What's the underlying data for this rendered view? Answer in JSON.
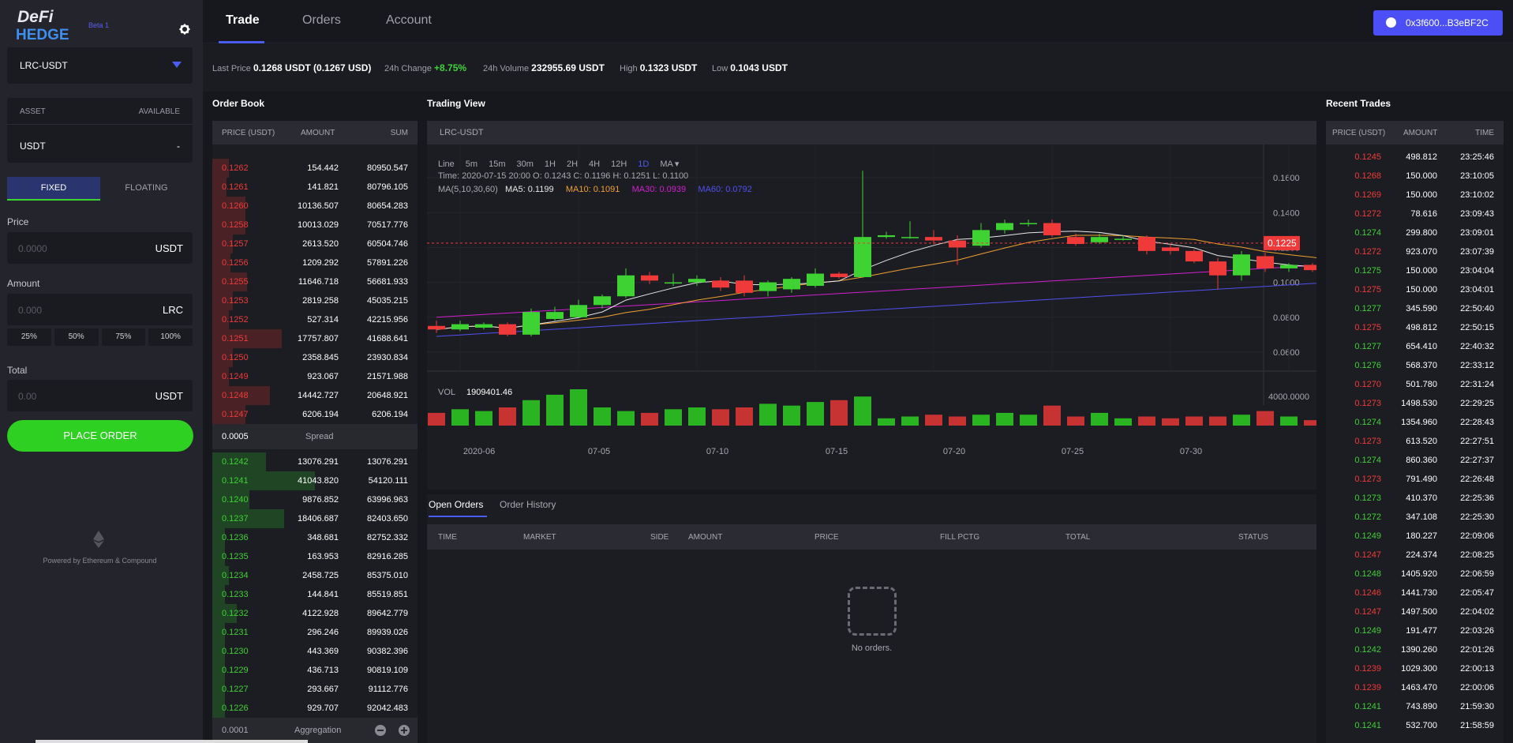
{
  "sidebar": {
    "logo_text": "DeFi HEDGE",
    "beta_label": "Beta 1",
    "pair": "LRC-USDT",
    "asset_header": "ASSET",
    "available_header": "AVAILABLE",
    "asset_name": "USDT",
    "asset_available": "-",
    "tab_fixed": "FIXED",
    "tab_floating": "FLOATING",
    "price_label": "Price",
    "price_placeholder": "0.0000",
    "price_unit": "USDT",
    "amount_label": "Amount",
    "amount_placeholder": "0.000",
    "amount_unit": "LRC",
    "pct": [
      "25%",
      "50%",
      "75%",
      "100%"
    ],
    "total_label": "Total",
    "total_placeholder": "0.00",
    "total_unit": "USDT",
    "place_order": "PLACE ORDER",
    "powered": "Powered by Ethereum & Compound"
  },
  "nav": {
    "trade": "Trade",
    "orders": "Orders",
    "account": "Account",
    "wallet": "0x3f600...B3eBF2C"
  },
  "ticker": {
    "last_price_label": "Last Price",
    "last_price": "0.1268 USDT (0.1267 USD)",
    "change_label": "24h Change",
    "change": "+8.75%",
    "volume_label": "24h Volume",
    "volume": "232955.69 USDT",
    "high_label": "High",
    "high": "0.1323 USDT",
    "low_label": "Low",
    "low": "0.1043 USDT"
  },
  "orderbook": {
    "title": "Order Book",
    "headers": [
      "PRICE (USDT)",
      "AMOUNT",
      "SUM"
    ],
    "asks": [
      {
        "price": "0.1262",
        "amount": "154.442",
        "sum": "80950.547",
        "depth": 0.08
      },
      {
        "price": "0.1261",
        "amount": "141.821",
        "sum": "80796.105",
        "depth": 0.07
      },
      {
        "price": "0.1260",
        "amount": "10136.507",
        "sum": "80654.283",
        "depth": 0.16
      },
      {
        "price": "0.1258",
        "amount": "10013.029",
        "sum": "70517.776",
        "depth": 0.16
      },
      {
        "price": "0.1257",
        "amount": "2613.520",
        "sum": "60504.746",
        "depth": 0.1
      },
      {
        "price": "0.1256",
        "amount": "1209.292",
        "sum": "57891.226",
        "depth": 0.09
      },
      {
        "price": "0.1255",
        "amount": "11646.718",
        "sum": "56681.933",
        "depth": 0.17
      },
      {
        "price": "0.1253",
        "amount": "2819.258",
        "sum": "45035.215",
        "depth": 0.1
      },
      {
        "price": "0.1252",
        "amount": "527.314",
        "sum": "42215.956",
        "depth": 0.08
      },
      {
        "price": "0.1251",
        "amount": "17757.807",
        "sum": "41688.641",
        "depth": 0.34
      },
      {
        "price": "0.1250",
        "amount": "2358.845",
        "sum": "23930.834",
        "depth": 0.1
      },
      {
        "price": "0.1249",
        "amount": "923.067",
        "sum": "21571.988",
        "depth": 0.08
      },
      {
        "price": "0.1248",
        "amount": "14442.727",
        "sum": "20648.921",
        "depth": 0.28
      },
      {
        "price": "0.1247",
        "amount": "6206.194",
        "sum": "6206.194",
        "depth": 0.16
      }
    ],
    "spread_value": "0.0005",
    "spread_label": "Spread",
    "bids": [
      {
        "price": "0.1242",
        "amount": "13076.291",
        "sum": "13076.291",
        "depth": 0.26
      },
      {
        "price": "0.1241",
        "amount": "41043.820",
        "sum": "54120.111",
        "depth": 0.5
      },
      {
        "price": "0.1240",
        "amount": "9876.852",
        "sum": "63996.963",
        "depth": 0.18
      },
      {
        "price": "0.1237",
        "amount": "18406.687",
        "sum": "82403.650",
        "depth": 0.35
      },
      {
        "price": "0.1236",
        "amount": "348.681",
        "sum": "82752.332",
        "depth": 0.06
      },
      {
        "price": "0.1235",
        "amount": "163.953",
        "sum": "82916.285",
        "depth": 0.06
      },
      {
        "price": "0.1234",
        "amount": "2458.725",
        "sum": "85375.010",
        "depth": 0.08
      },
      {
        "price": "0.1233",
        "amount": "144.841",
        "sum": "85519.851",
        "depth": 0.06
      },
      {
        "price": "0.1232",
        "amount": "4122.928",
        "sum": "89642.779",
        "depth": 0.12
      },
      {
        "price": "0.1231",
        "amount": "296.246",
        "sum": "89939.026",
        "depth": 0.06
      },
      {
        "price": "0.1230",
        "amount": "443.369",
        "sum": "90382.396",
        "depth": 0.06
      },
      {
        "price": "0.1229",
        "amount": "436.713",
        "sum": "90819.109",
        "depth": 0.06
      },
      {
        "price": "0.1227",
        "amount": "293.667",
        "sum": "91112.776",
        "depth": 0.06
      },
      {
        "price": "0.1226",
        "amount": "929.707",
        "sum": "92042.483",
        "depth": 0.06
      }
    ],
    "agg_value": "0.0001",
    "agg_label": "Aggregation"
  },
  "tradingview": {
    "title": "Trading View",
    "symbol": "LRC-USDT",
    "intervals": [
      "Line",
      "5m",
      "15m",
      "30m",
      "1H",
      "2H",
      "4H",
      "12H",
      "1D",
      "MA"
    ],
    "selected_interval": "1D",
    "info": "Time: 2020-07-15 20:00    O: 0.1243    C: 0.1196    H: 0.1251    L: 0.1100",
    "ma_label": "MA(5,10,30,60)",
    "ma5": "MA5: 0.1199",
    "ma10": "MA10: 0.1091",
    "ma30": "MA30: 0.0939",
    "ma60": "MA60: 0.0792",
    "vol_label": "VOL",
    "vol_value": "1909401.46",
    "vol_axis": "4000.0000",
    "last_marker": "0.1225"
  },
  "chart_data": {
    "type": "candlestick",
    "y_ticks": [
      "0.1600",
      "0.1400",
      "0.1200",
      "0.1000",
      "0.0800",
      "0.0600"
    ],
    "ylim": [
      0.05,
      0.17
    ],
    "x_labels": [
      "2020-06",
      "07-05",
      "07-10",
      "07-15",
      "07-20",
      "07-25",
      "07-30"
    ],
    "candles": [
      [
        0.075,
        0.073,
        0.078,
        0.071,
        1
      ],
      [
        0.073,
        0.076,
        0.078,
        0.072,
        0
      ],
      [
        0.074,
        0.076,
        0.077,
        0.073,
        2
      ],
      [
        0.076,
        0.07,
        0.077,
        0.069,
        3
      ],
      [
        0.07,
        0.083,
        0.085,
        0.069,
        2
      ],
      [
        0.079,
        0.083,
        0.086,
        0.078,
        2
      ],
      [
        0.08,
        0.087,
        0.09,
        0.08,
        3
      ],
      [
        0.087,
        0.092,
        0.093,
        0.085,
        4
      ],
      [
        0.092,
        0.104,
        0.108,
        0.091,
        6
      ],
      [
        0.104,
        0.101,
        0.106,
        0.099,
        3
      ],
      [
        0.1,
        0.1,
        0.105,
        0.098,
        2
      ],
      [
        0.1,
        0.102,
        0.104,
        0.098,
        2
      ],
      [
        0.101,
        0.097,
        0.103,
        0.095,
        2
      ],
      [
        0.101,
        0.094,
        0.104,
        0.092,
        3
      ],
      [
        0.095,
        0.1,
        0.101,
        0.092,
        3
      ],
      [
        0.096,
        0.102,
        0.103,
        0.094,
        2
      ],
      [
        0.098,
        0.105,
        0.108,
        0.097,
        4
      ],
      [
        0.105,
        0.103,
        0.106,
        0.102,
        3
      ],
      [
        0.103,
        0.126,
        0.164,
        0.103,
        5
      ],
      [
        0.126,
        0.127,
        0.129,
        0.125,
        1
      ],
      [
        0.126,
        0.126,
        0.135,
        0.125,
        1
      ],
      [
        0.126,
        0.124,
        0.13,
        0.122,
        1
      ],
      [
        0.124,
        0.12,
        0.127,
        0.11,
        2
      ],
      [
        0.121,
        0.13,
        0.134,
        0.12,
        2
      ],
      [
        0.13,
        0.134,
        0.136,
        0.128,
        2
      ],
      [
        0.134,
        0.134,
        0.136,
        0.132,
        1
      ],
      [
        0.134,
        0.127,
        0.136,
        0.126,
        3
      ],
      [
        0.126,
        0.122,
        0.128,
        0.121,
        1
      ],
      [
        0.123,
        0.126,
        0.128,
        0.122,
        2
      ],
      [
        0.125,
        0.125,
        0.127,
        0.124,
        1
      ],
      [
        0.126,
        0.118,
        0.127,
        0.116,
        2
      ],
      [
        0.12,
        0.118,
        0.122,
        0.116,
        1
      ],
      [
        0.118,
        0.112,
        0.119,
        0.111,
        2
      ],
      [
        0.112,
        0.104,
        0.114,
        0.096,
        3
      ],
      [
        0.104,
        0.116,
        0.118,
        0.101,
        3
      ],
      [
        0.115,
        0.108,
        0.117,
        0.106,
        2
      ],
      [
        0.108,
        0.11,
        0.111,
        0.106,
        1
      ],
      [
        0.11,
        0.107,
        0.111,
        0.106,
        1
      ],
      [
        0.107,
        0.108,
        0.11,
        0.105,
        1
      ],
      [
        0.109,
        0.126,
        0.132,
        0.107,
        3
      ],
      [
        0.126,
        0.123,
        0.127,
        0.12,
        1
      ]
    ],
    "vol_fractions": [
      0.35,
      0.45,
      0.4,
      0.5,
      0.7,
      0.85,
      1.0,
      0.5,
      0.4,
      0.35,
      0.45,
      0.5,
      0.45,
      0.5,
      0.6,
      0.55,
      0.65,
      0.7,
      0.8,
      0.2,
      0.25,
      0.3,
      0.25,
      0.3,
      0.35,
      0.3,
      0.55,
      0.25,
      0.35,
      0.2,
      0.25,
      0.2,
      0.25,
      0.25,
      0.3,
      0.4,
      0.25,
      0.15,
      0.2,
      0.55,
      0.15
    ]
  },
  "orders": {
    "tab_open": "Open Orders",
    "tab_history": "Order History",
    "headers": [
      "TIME",
      "MARKET",
      "SIDE",
      "AMOUNT",
      "PRICE",
      "FILL PCTG",
      "TOTAL",
      "STATUS"
    ],
    "empty": "No orders."
  },
  "recent": {
    "title": "Recent Trades",
    "headers": [
      "PRICE (USDT)",
      "AMOUNT",
      "TIME"
    ],
    "rows": [
      {
        "price": "0.1245",
        "amount": "498.812",
        "time": "23:25:46",
        "side": "sell"
      },
      {
        "price": "0.1268",
        "amount": "150.000",
        "time": "23:10:05",
        "side": "sell"
      },
      {
        "price": "0.1269",
        "amount": "150.000",
        "time": "23:10:02",
        "side": "sell"
      },
      {
        "price": "0.1272",
        "amount": "78.616",
        "time": "23:09:43",
        "side": "sell"
      },
      {
        "price": "0.1274",
        "amount": "299.800",
        "time": "23:09:01",
        "side": "buy"
      },
      {
        "price": "0.1272",
        "amount": "923.070",
        "time": "23:07:39",
        "side": "sell"
      },
      {
        "price": "0.1275",
        "amount": "150.000",
        "time": "23:04:04",
        "side": "buy"
      },
      {
        "price": "0.1275",
        "amount": "150.000",
        "time": "23:04:01",
        "side": "sell"
      },
      {
        "price": "0.1277",
        "amount": "345.590",
        "time": "22:50:40",
        "side": "buy"
      },
      {
        "price": "0.1275",
        "amount": "498.812",
        "time": "22:50:15",
        "side": "sell"
      },
      {
        "price": "0.1277",
        "amount": "654.410",
        "time": "22:40:32",
        "side": "buy"
      },
      {
        "price": "0.1276",
        "amount": "568.370",
        "time": "22:33:12",
        "side": "buy"
      },
      {
        "price": "0.1270",
        "amount": "501.780",
        "time": "22:31:24",
        "side": "sell"
      },
      {
        "price": "0.1273",
        "amount": "1498.530",
        "time": "22:29:25",
        "side": "sell"
      },
      {
        "price": "0.1274",
        "amount": "1354.960",
        "time": "22:28:43",
        "side": "buy"
      },
      {
        "price": "0.1273",
        "amount": "613.520",
        "time": "22:27:51",
        "side": "sell"
      },
      {
        "price": "0.1274",
        "amount": "860.360",
        "time": "22:27:37",
        "side": "buy"
      },
      {
        "price": "0.1273",
        "amount": "791.490",
        "time": "22:26:48",
        "side": "sell"
      },
      {
        "price": "0.1273",
        "amount": "410.370",
        "time": "22:25:36",
        "side": "buy"
      },
      {
        "price": "0.1272",
        "amount": "347.108",
        "time": "22:25:30",
        "side": "buy"
      },
      {
        "price": "0.1249",
        "amount": "180.227",
        "time": "22:09:06",
        "side": "buy"
      },
      {
        "price": "0.1247",
        "amount": "224.374",
        "time": "22:08:25",
        "side": "sell"
      },
      {
        "price": "0.1248",
        "amount": "1405.920",
        "time": "22:06:59",
        "side": "buy"
      },
      {
        "price": "0.1246",
        "amount": "1441.730",
        "time": "22:05:47",
        "side": "sell"
      },
      {
        "price": "0.1247",
        "amount": "1497.500",
        "time": "22:04:02",
        "side": "sell"
      },
      {
        "price": "0.1249",
        "amount": "191.477",
        "time": "22:03:26",
        "side": "buy"
      },
      {
        "price": "0.1242",
        "amount": "1390.260",
        "time": "22:01:26",
        "side": "buy"
      },
      {
        "price": "0.1239",
        "amount": "1029.300",
        "time": "22:00:13",
        "side": "sell"
      },
      {
        "price": "0.1239",
        "amount": "1463.470",
        "time": "22:00:06",
        "side": "sell"
      },
      {
        "price": "0.1241",
        "amount": "743.890",
        "time": "21:59:30",
        "side": "buy"
      },
      {
        "price": "0.1241",
        "amount": "532.700",
        "time": "21:58:59",
        "side": "buy"
      }
    ]
  },
  "colors": {
    "up": "#3fd233",
    "down": "#f03a3a",
    "accent": "#4b4ff5",
    "ma5": "#e8e8e8",
    "ma10": "#f0a030",
    "ma30": "#d020d0",
    "ma60": "#5050f0"
  }
}
